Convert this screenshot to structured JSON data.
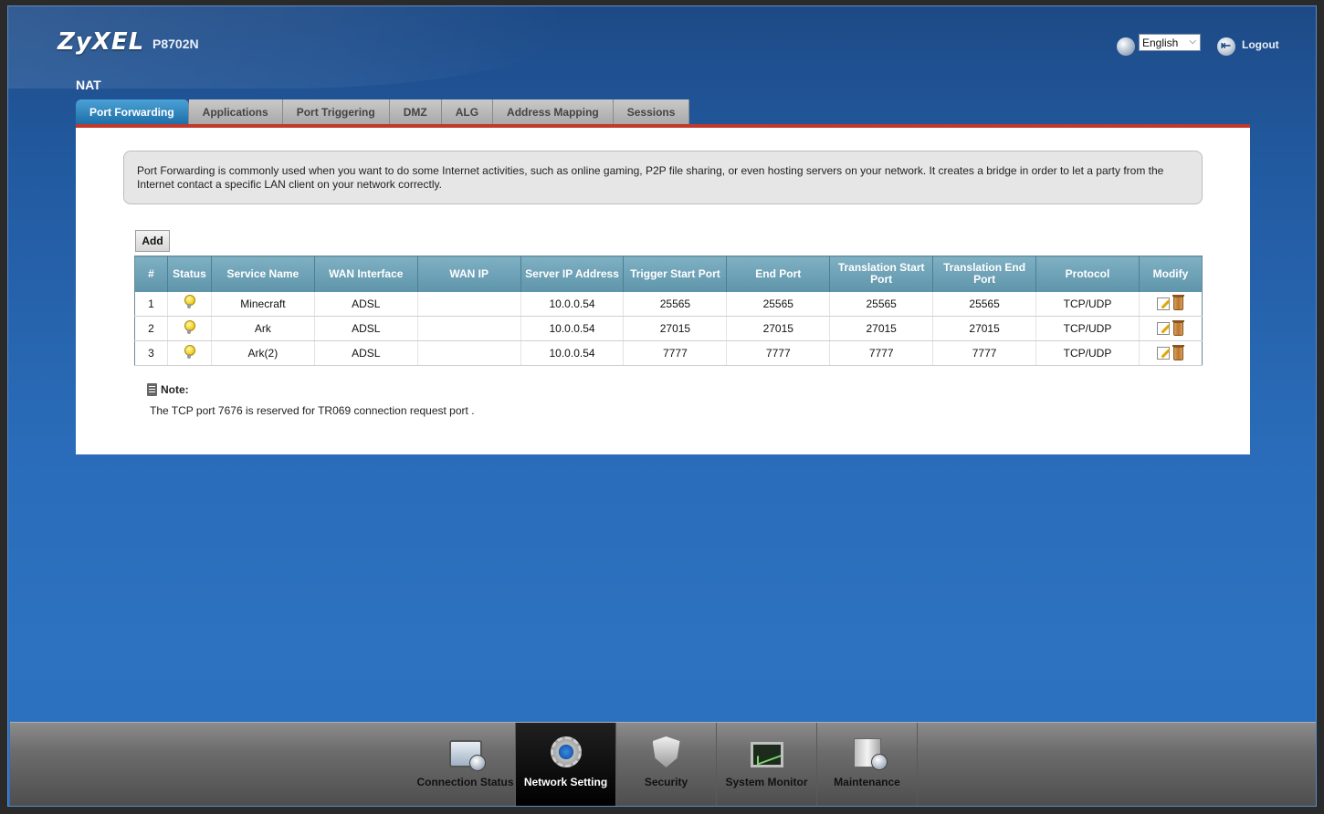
{
  "header": {
    "brand": "ZyXEL",
    "model": "P8702N",
    "language": "English",
    "logout_label": "Logout"
  },
  "page": {
    "title": "NAT"
  },
  "tabs": [
    {
      "label": "Port Forwarding",
      "active": true
    },
    {
      "label": "Applications",
      "active": false
    },
    {
      "label": "Port Triggering",
      "active": false
    },
    {
      "label": "DMZ",
      "active": false
    },
    {
      "label": "ALG",
      "active": false
    },
    {
      "label": "Address Mapping",
      "active": false
    },
    {
      "label": "Sessions",
      "active": false
    }
  ],
  "info": {
    "text": "Port Forwarding is commonly used when you want to do some Internet activities, such as online gaming, P2P file sharing, or even hosting servers on your network. It creates a bridge in order to let a party from the Internet contact a specific LAN client on your network correctly."
  },
  "add_label": "Add",
  "table": {
    "columns": [
      "#",
      "Status",
      "Service Name",
      "WAN Interface",
      "WAN IP",
      "Server IP Address",
      "Trigger Start Port",
      "End Port",
      "Translation Start Port",
      "Translation End Port",
      "Protocol",
      "Modify"
    ],
    "rows": [
      {
        "num": "1",
        "service": "Minecraft",
        "wan_if": "ADSL",
        "wan_ip": "",
        "server_ip": "10.0.0.54",
        "trig_start": "25565",
        "end_port": "25565",
        "trans_start": "25565",
        "trans_end": "25565",
        "protocol": "TCP/UDP"
      },
      {
        "num": "2",
        "service": "Ark",
        "wan_if": "ADSL",
        "wan_ip": "",
        "server_ip": "10.0.0.54",
        "trig_start": "27015",
        "end_port": "27015",
        "trans_start": "27015",
        "trans_end": "27015",
        "protocol": "TCP/UDP"
      },
      {
        "num": "3",
        "service": "Ark(2)",
        "wan_if": "ADSL",
        "wan_ip": "",
        "server_ip": "10.0.0.54",
        "trig_start": "7777",
        "end_port": "7777",
        "trans_start": "7777",
        "trans_end": "7777",
        "protocol": "TCP/UDP"
      }
    ]
  },
  "note": {
    "title": "Note:",
    "text": "The TCP port 7676 is reserved for TR069 connection request port ."
  },
  "nav": [
    {
      "label": "Connection Status",
      "icon": "connection-status-icon",
      "active": false
    },
    {
      "label": "Network Setting",
      "icon": "gear-icon",
      "active": true
    },
    {
      "label": "Security",
      "icon": "shield-icon",
      "active": false
    },
    {
      "label": "System Monitor",
      "icon": "monitor-icon",
      "active": false
    },
    {
      "label": "Maintenance",
      "icon": "maintenance-icon",
      "active": false
    }
  ]
}
